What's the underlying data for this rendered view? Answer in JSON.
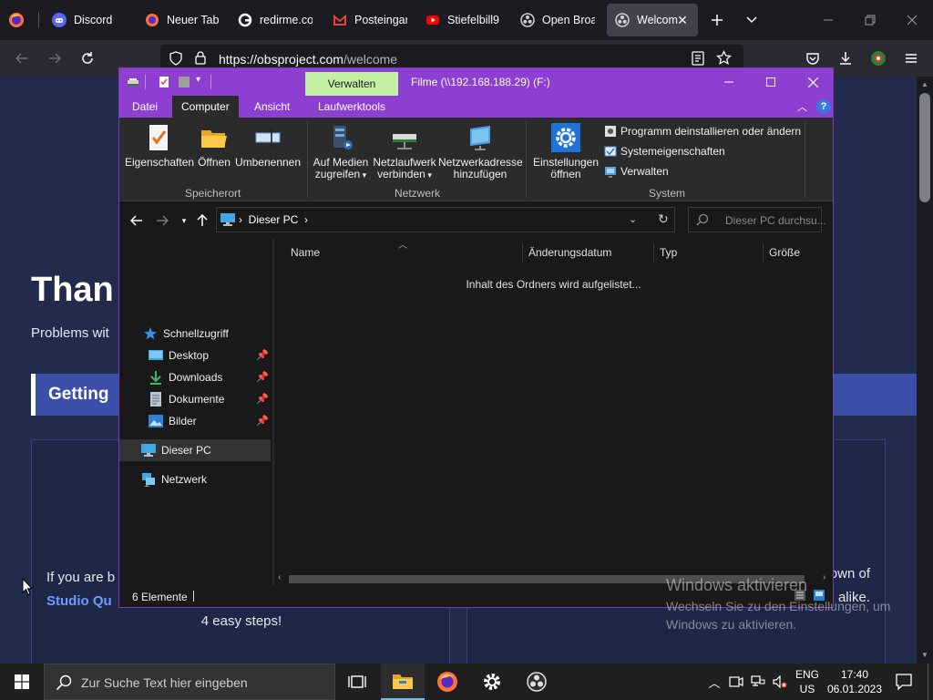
{
  "browser": {
    "tabs": [
      {
        "title": "Discord",
        "icon": "discord-icon"
      },
      {
        "title": "Neuer Tab",
        "icon": "firefox-icon"
      },
      {
        "title": "redirme.co",
        "icon": "google-icon"
      },
      {
        "title": "Posteingar",
        "icon": "gmail-icon"
      },
      {
        "title": "Stiefelbill9",
        "icon": "youtube-icon"
      },
      {
        "title": "Open Broa",
        "icon": "obs-icon"
      },
      {
        "title": "Welcom",
        "icon": "obs-icon",
        "active": true
      }
    ],
    "url_host": "https://obsproject.com",
    "url_path": "/welcome"
  },
  "webpage": {
    "heading": "Than",
    "subtext": "Problems wit",
    "banner": "Getting",
    "card1_text": "If you are b",
    "card1_link": "Studio Qu",
    "card1_steps": "4 easy steps!",
    "card2_text_a": "own of",
    "card2_text_b": "alike."
  },
  "explorer": {
    "title": "Filme (\\\\192.168.188.29) (F:)",
    "context_tab": "Verwalten",
    "ribbon_tabs": [
      "Datei",
      "Computer",
      "Ansicht",
      "Laufwerktools"
    ],
    "ribbon": {
      "eigenschaften": "Eigenschaften",
      "oeffnen": "Öffnen",
      "umbenennen": "Umbenennen",
      "medien_1": "Auf Medien",
      "medien_2": "zugreifen",
      "netzlaufwerk_1": "Netzlaufwerk",
      "netzlaufwerk_2": "verbinden",
      "netzwerkadresse_1": "Netzwerkadresse",
      "netzwerkadresse_2": "hinzufügen",
      "einstellungen_1": "Einstellungen",
      "einstellungen_2": "öffnen",
      "programm": "Programm deinstallieren oder ändern",
      "systemeigenschaften": "Systemeigenschaften",
      "verwalten": "Verwalten",
      "group_speicherort": "Speicherort",
      "group_netzwerk": "Netzwerk",
      "group_system": "System"
    },
    "breadcrumb": "Dieser PC",
    "search_placeholder": "Dieser PC durchsu...",
    "nav": {
      "schnellzugriff": "Schnellzugriff",
      "desktop": "Desktop",
      "downloads": "Downloads",
      "dokumente": "Dokumente",
      "bilder": "Bilder",
      "dieser_pc": "Dieser PC",
      "netzwerk": "Netzwerk"
    },
    "columns": [
      "Name",
      "Änderungsdatum",
      "Typ",
      "Größe"
    ],
    "content_status": "Inhalt des Ordners wird aufgelistet...",
    "status_count": "6 Elemente"
  },
  "activation": {
    "title": "Windows aktivieren",
    "subtitle": "Wechseln Sie zu den Einstellungen, um Windows zu aktivieren."
  },
  "taskbar": {
    "search_text": "Zur Suche Text hier eingeben",
    "lang_1": "ENG",
    "lang_2": "US",
    "time": "17:40",
    "date": "06.01.2023"
  },
  "colors": {
    "explorer_accent": "#8c3fd1",
    "verwalten_tab": "#c4f0a4",
    "page_background": "#232b4d",
    "taskbar": "#1f1f1f"
  }
}
